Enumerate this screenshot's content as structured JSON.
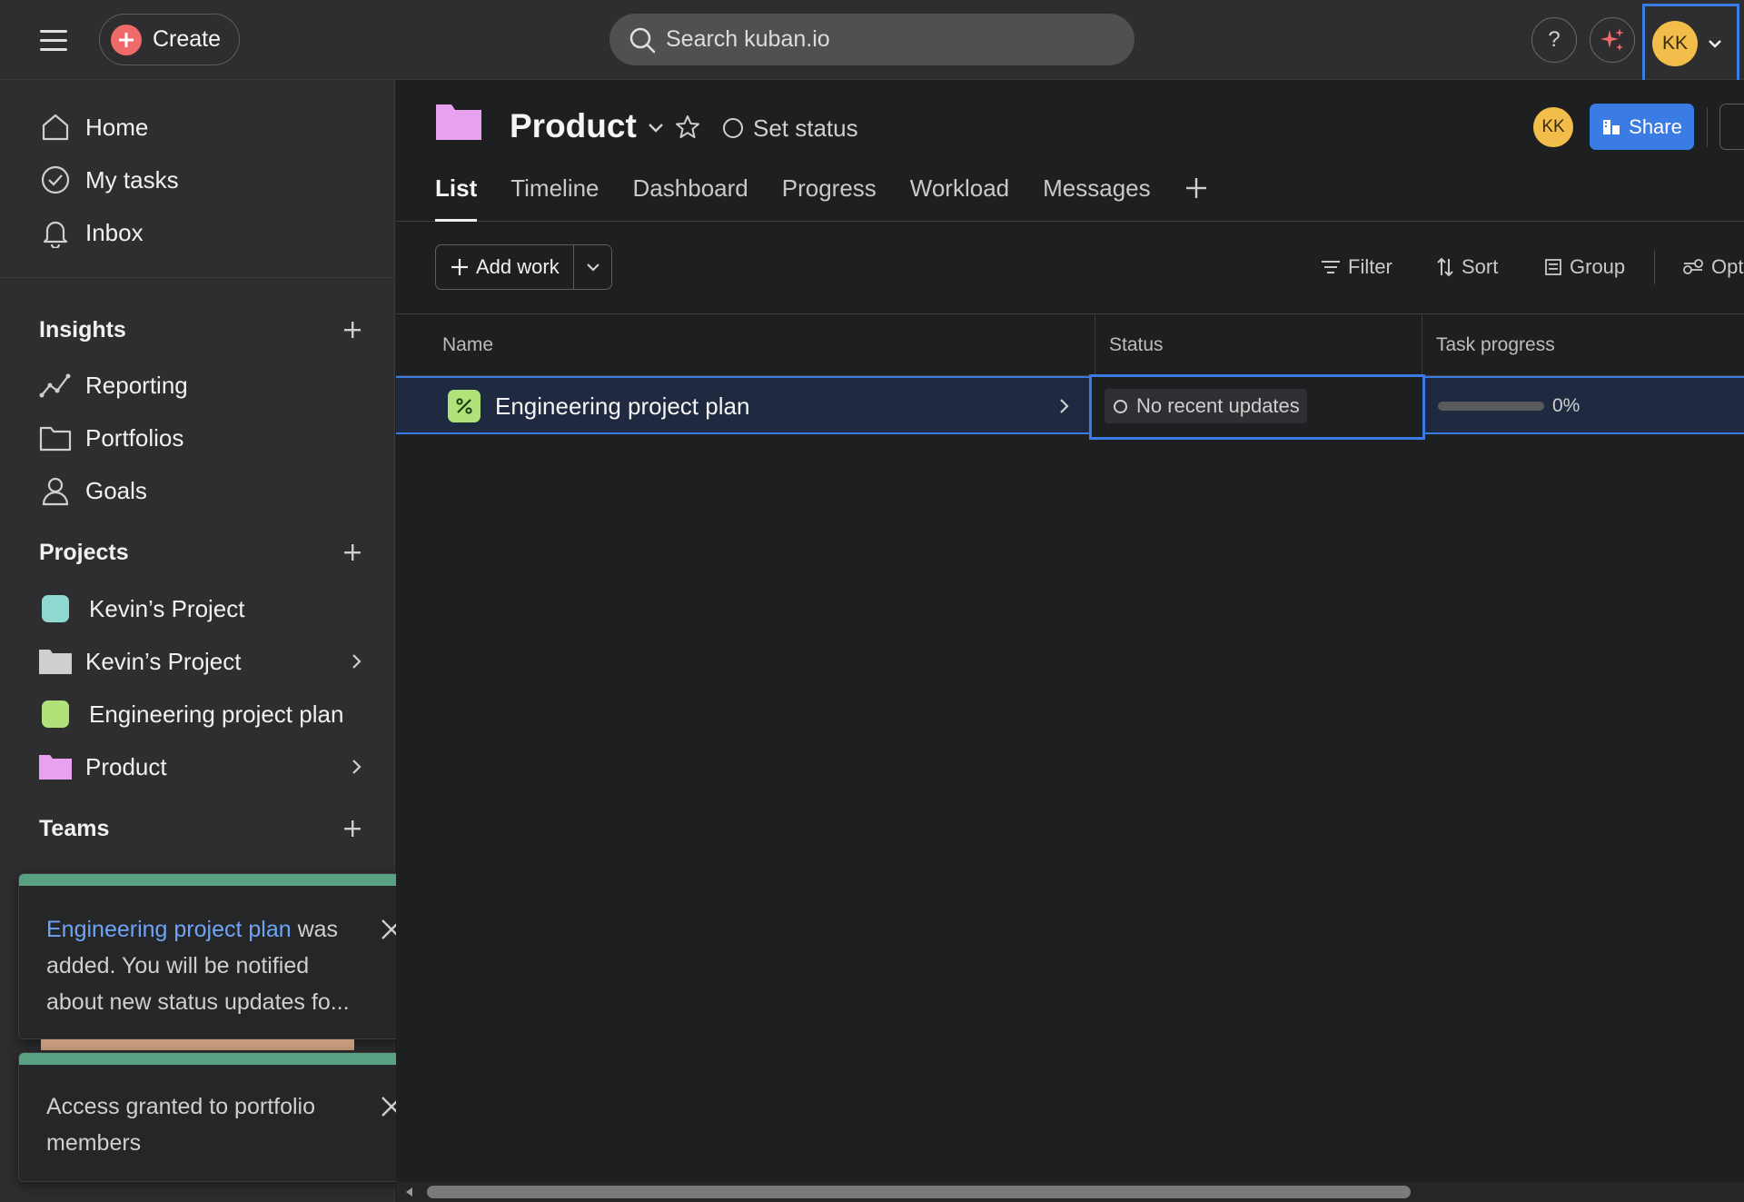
{
  "topbar": {
    "create_label": "Create",
    "search_placeholder": "Search kuban.io",
    "help_label": "?",
    "user_initials": "KK"
  },
  "sidebar": {
    "nav": [
      {
        "label": "Home",
        "icon": "home-icon"
      },
      {
        "label": "My tasks",
        "icon": "check-circle-icon"
      },
      {
        "label": "Inbox",
        "icon": "bell-icon"
      }
    ],
    "insights": {
      "title": "Insights",
      "items": [
        {
          "label": "Reporting",
          "icon": "chart-line-icon"
        },
        {
          "label": "Portfolios",
          "icon": "folder-icon"
        },
        {
          "label": "Goals",
          "icon": "person-icon"
        }
      ]
    },
    "projects": {
      "title": "Projects",
      "items": [
        {
          "label": "Kevin’s Project",
          "color": "#8ed8d0"
        },
        {
          "label": "Kevin’s Project",
          "color": "#cfcfcf"
        },
        {
          "label": "Engineering project plan",
          "color": "#b1e27a"
        },
        {
          "label": "Product",
          "color": "#e8a1ee"
        }
      ]
    },
    "teams": {
      "title": "Teams"
    }
  },
  "toasts": [
    {
      "link": "Engineering project plan",
      "text": " was added. You will be notified about new status updates fo..."
    },
    {
      "text": "Access granted to portfolio members"
    }
  ],
  "project": {
    "title": "Product",
    "folder_color": "#e8a1ee",
    "set_status": "Set status",
    "member_initials": "KK",
    "share_label": "Share",
    "tabs": [
      "List",
      "Timeline",
      "Dashboard",
      "Progress",
      "Workload",
      "Messages"
    ],
    "active_tab": "List"
  },
  "toolbar": {
    "add_work": "Add work",
    "filter": "Filter",
    "sort": "Sort",
    "group": "Group",
    "options": "Opt"
  },
  "table": {
    "columns": [
      "Name",
      "Status",
      "Task progress"
    ],
    "rows": [
      {
        "name": "Engineering project plan",
        "status": "No recent updates",
        "progress": "0%",
        "progress_value": 0
      }
    ]
  },
  "colors": {
    "accent": "#3b7ce4",
    "create": "#f06a6a",
    "avatar": "#f2bd4a",
    "toast_bar": "#58a182"
  }
}
